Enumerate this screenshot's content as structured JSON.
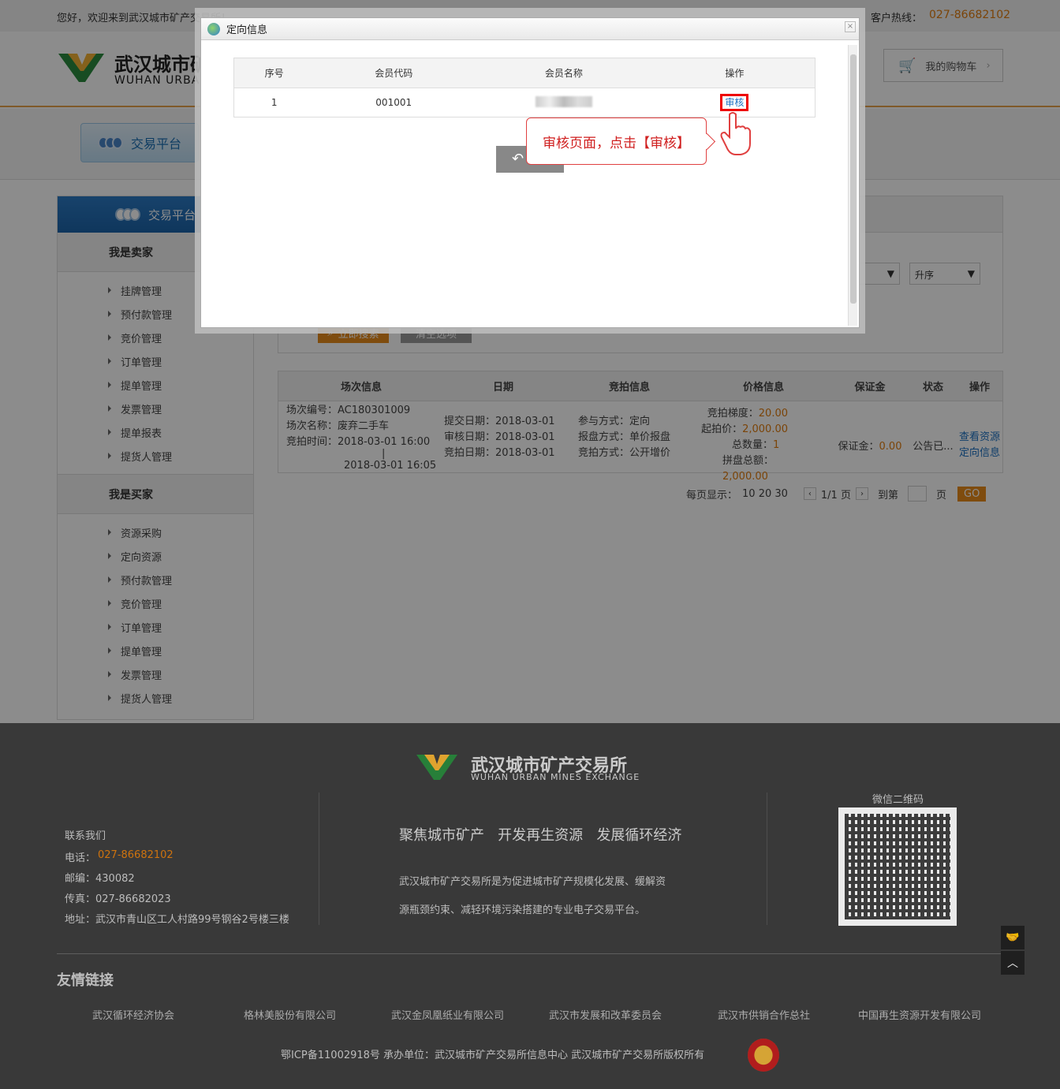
{
  "topbar": {
    "welcome": "您好，欢迎来到武汉城市矿产交易所！",
    "hotline_label": "客户热线：",
    "hotline": "027-86682102"
  },
  "header": {
    "logo_cn": "武汉城市矿产交易所",
    "logo_en": "WUHAN URBAN MINES EXCHANGE",
    "cart": "我的购物车"
  },
  "nav": {
    "tab": "交易平台"
  },
  "sidebar": {
    "head": "交易平台",
    "seller_title": "我是卖家",
    "seller_items": [
      "挂牌管理",
      "预付款管理",
      "竞价管理",
      "订单管理",
      "提单管理",
      "发票管理",
      "提单报表",
      "提货人管理"
    ],
    "buyer_title": "我是买家",
    "buyer_items": [
      "资源采购",
      "定向资源",
      "预付款管理",
      "竞价管理",
      "订单管理",
      "提单管理",
      "发票管理",
      "提货人管理"
    ]
  },
  "filters": {
    "order": "升序",
    "search_btn": "立即搜索",
    "clear_btn": "清空选项"
  },
  "table": {
    "headers": [
      "场次信息",
      "日期",
      "竞拍信息",
      "价格信息",
      "保证金",
      "状态",
      "操作"
    ],
    "row": {
      "session_no": "场次编号：AC180301009",
      "session_name": "场次名称：废弃二手车",
      "auction_time": "竞拍时间：2018-03-01 16:00",
      "auction_time_sep": "|",
      "auction_end": "2018-03-01 16:05",
      "submit_date": "提交日期：2018-03-01",
      "audit_date": "审核日期：2018-03-01",
      "auction_date": "竞拍日期：2018-03-01",
      "join": "参与方式：定向",
      "quote": "报盘方式：单价报盘",
      "bid": "竞拍方式：公开增价",
      "step_label": "竞拍梯度：",
      "step": "20.00",
      "start_label": "起拍价：",
      "start": "2,000.00",
      "qty_label": "总数量：",
      "qty": "1",
      "total_label": "拼盘总额：",
      "total": "2,000.00",
      "deposit_label": "保证金：",
      "deposit": "0.00",
      "status": "公告已...",
      "op1": "查看资源",
      "op2": "定向信息"
    }
  },
  "pager": {
    "per_page": "每页显示：",
    "sizes": "10 20 30",
    "page": "1/1 页",
    "goto": "到第",
    "unit": "页",
    "go": "GO"
  },
  "dialog": {
    "title": "定向信息",
    "close": "×",
    "headers": [
      "序号",
      "会员代码",
      "会员名称",
      "操作"
    ],
    "row": {
      "no": "1",
      "code": "001001",
      "action": "审核"
    },
    "tip": "审核页面，点击【审核】"
  },
  "footer": {
    "logo_cn": "武汉城市矿产交易所",
    "logo_en": "WUHAN URBAN MINES EXCHANGE",
    "contact_title": "联系我们",
    "phone_label": "电话：",
    "phone": "027-86682102",
    "zip": "邮编：430082",
    "fax": "传真：027-86682023",
    "address": "地址：武汉市青山区工人村路99号钢谷2号楼三楼",
    "slogan": "聚焦城市矿产   开发再生资源   发展循环经济",
    "desc1": "武汉城市矿产交易所是为促进城市矿产规模化发展、缓解资",
    "desc2": "源瓶颈约束、减轻环境污染搭建的专业电子交易平台。",
    "qr_label": "微信二维码",
    "links_title": "友情链接",
    "links": [
      "武汉循环经济协会",
      "格林美股份有限公司",
      "武汉金凤凰纸业有限公司",
      "武汉市发展和改革委员会",
      "武汉市供销合作总社",
      "中国再生资源开发有限公司"
    ],
    "copyright": "鄂ICP备11002918号  承办单位：武汉城市矿产交易所信息中心  武汉城市矿产交易所版权所有"
  }
}
